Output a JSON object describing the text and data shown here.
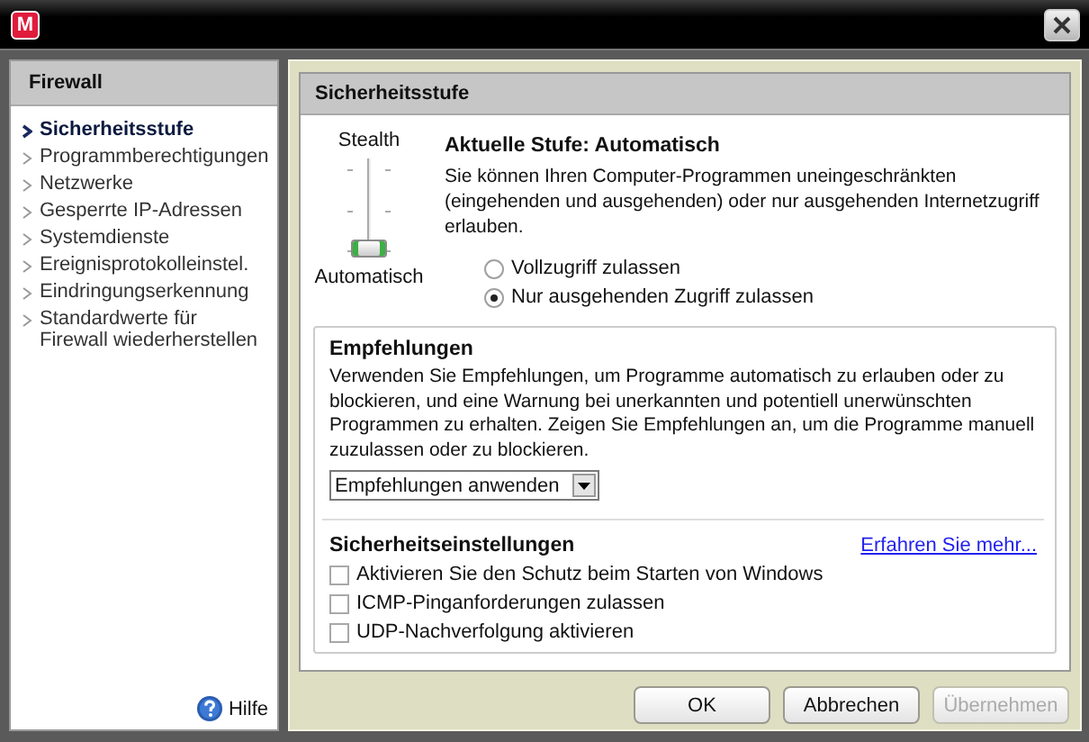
{
  "window": {
    "logo": "M"
  },
  "sidebar": {
    "title": "Firewall",
    "items": [
      {
        "label": "Sicherheitsstufe",
        "selected": true
      },
      {
        "label": "Programmberechtigungen",
        "selected": false
      },
      {
        "label": "Netzwerke",
        "selected": false
      },
      {
        "label": "Gesperrte IP-Adressen",
        "selected": false
      },
      {
        "label": "Systemdienste",
        "selected": false
      },
      {
        "label": "Ereignisprotokolleinstel.",
        "selected": false
      },
      {
        "label": "Eindringungserkennung",
        "selected": false
      },
      {
        "label": "Standardwerte für Firewall wiederherstellen",
        "selected": false
      }
    ],
    "help": "Hilfe"
  },
  "panel": {
    "title": "Sicherheitsstufe",
    "slider": {
      "top_label": "Stealth",
      "bottom_label": "Automatisch",
      "level": 0
    },
    "current": "Aktuelle Stufe:  Automatisch",
    "description": "Sie können Ihren Computer-Programmen uneingeschränkten (eingehenden und ausgehenden) oder nur ausgehenden Internetzugriff erlauben.",
    "options": [
      {
        "label": "Vollzugriff zulassen",
        "selected": false
      },
      {
        "label": "Nur ausgehenden Zugriff zulassen",
        "selected": true
      }
    ],
    "recommendations": {
      "title": "Empfehlungen",
      "text": "Verwenden Sie Empfehlungen, um Programme automatisch zu erlauben oder zu blockieren, und eine Warnung bei unerkannten und potentiell unerwünschten Programmen zu erhalten. Zeigen Sie Empfehlungen an, um die Programme manuell zuzulassen oder zu blockieren.",
      "dropdown": "Empfehlungen anwenden"
    },
    "security": {
      "title": "Sicherheitseinstellungen",
      "link": "Erfahren Sie mehr...",
      "checks": [
        {
          "label": "Aktivieren Sie den Schutz beim Starten von Windows",
          "checked": false
        },
        {
          "label": "ICMP-Pinganforderungen zulassen",
          "checked": false
        },
        {
          "label": "UDP-Nachverfolgung aktivieren",
          "checked": false
        }
      ]
    }
  },
  "buttons": [
    {
      "label": "OK",
      "disabled": false
    },
    {
      "label": "Abbrechen",
      "disabled": false
    },
    {
      "label": "Übernehmen",
      "disabled": true
    }
  ]
}
